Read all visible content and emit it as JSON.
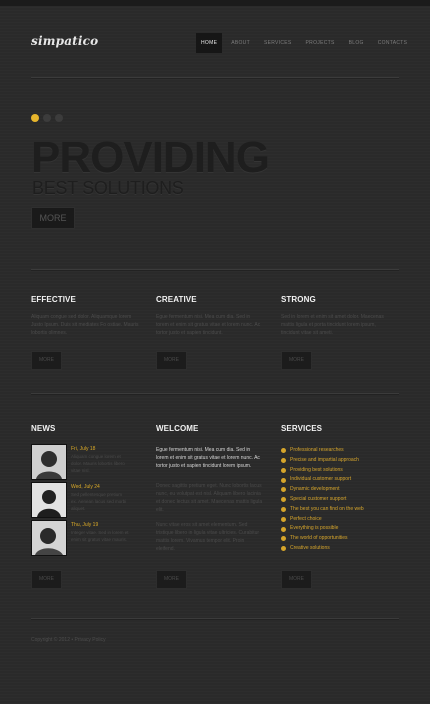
{
  "brand": {
    "logo": "simpatico",
    "accent": "#e6b52c"
  },
  "nav": [
    {
      "label": "HOME",
      "active": true
    },
    {
      "label": "ABOUT"
    },
    {
      "label": "SERVICES"
    },
    {
      "label": "PROJECTS"
    },
    {
      "label": "BLOG"
    },
    {
      "label": "CONTACTS"
    }
  ],
  "hero": {
    "title": "PROVIDING",
    "subtitle": "BEST SOLUTIONS",
    "button": "MORE",
    "slides": 3,
    "active_slide": 1
  },
  "features": [
    {
      "title": "EFFECTIVE",
      "text": "Aliquam congue sed dolor. Aliquamque lorem Justo Ipsum. Duis sit mediates Fo ostiae. Mauris lobortis olimnes.",
      "button": "MORE"
    },
    {
      "title": "CREATIVE",
      "text": "Egue fermentum nisi. Mea cum dia. Sed in torem et enim sit gratus vitae et lorem nunc. Ac tortor justo et sapien tincidunt.",
      "button": "MORE"
    },
    {
      "title": "STRONG",
      "text": "Sed in lorem et enim sit amet dolor. Maecenas mattis ligula et porta tincidunt lorem ipsum, tincidunt vitae sit ameti.",
      "button": "MORE"
    }
  ],
  "news": {
    "title": "NEWS",
    "items": [
      {
        "date": "Fri, July 18",
        "text": "Aliquam congue lorem et dolor. Mauris lobortis libero vitae nisl."
      },
      {
        "date": "Wed, July 24",
        "text": "Sed pellentesque pretium ex. Aenean lacus sed morbi aliquet."
      },
      {
        "date": "Thu, July 19",
        "text": "Integer vitae. Sed in lorem et enim sit gratus vitae mauris."
      }
    ],
    "button": "MORE"
  },
  "welcome": {
    "title": "WELCOME",
    "lead": "Egue fermentum nisi. Mea cum dia. Sed in lorem et enim sit gratus vitae et lorem nunc. Ac tortor justo et sapien tincidunt lorem ipsum.",
    "p1": "Donec sagittis pretium eget. Nunc lobortis lacus nunc, eu volutpat est nisl. Aliquam libero lacinia et donec lectus sit amet. Maecenas mattis ligula elit.",
    "p2": "Nunc vitae eros sit amet elementum. Sed tristique libero in ligula vitae ultricies. Curabitur mattis lorem. Vivamus tempor elit. Proin eleifend.",
    "button": "MORE"
  },
  "services": {
    "title": "SERVICES",
    "items": [
      "Professional researches",
      "Precise and impartial approach",
      "Providing best solutions",
      "Individual customer support",
      "Dynamic development",
      "Special customer support",
      "The best you can find on the web",
      "Perfect choice",
      "Everything is possible",
      "The world of opportunities",
      "Creative solutions"
    ],
    "button": "MORE"
  },
  "footer": {
    "text": "Copyright © 2012 • Privacy Policy"
  }
}
